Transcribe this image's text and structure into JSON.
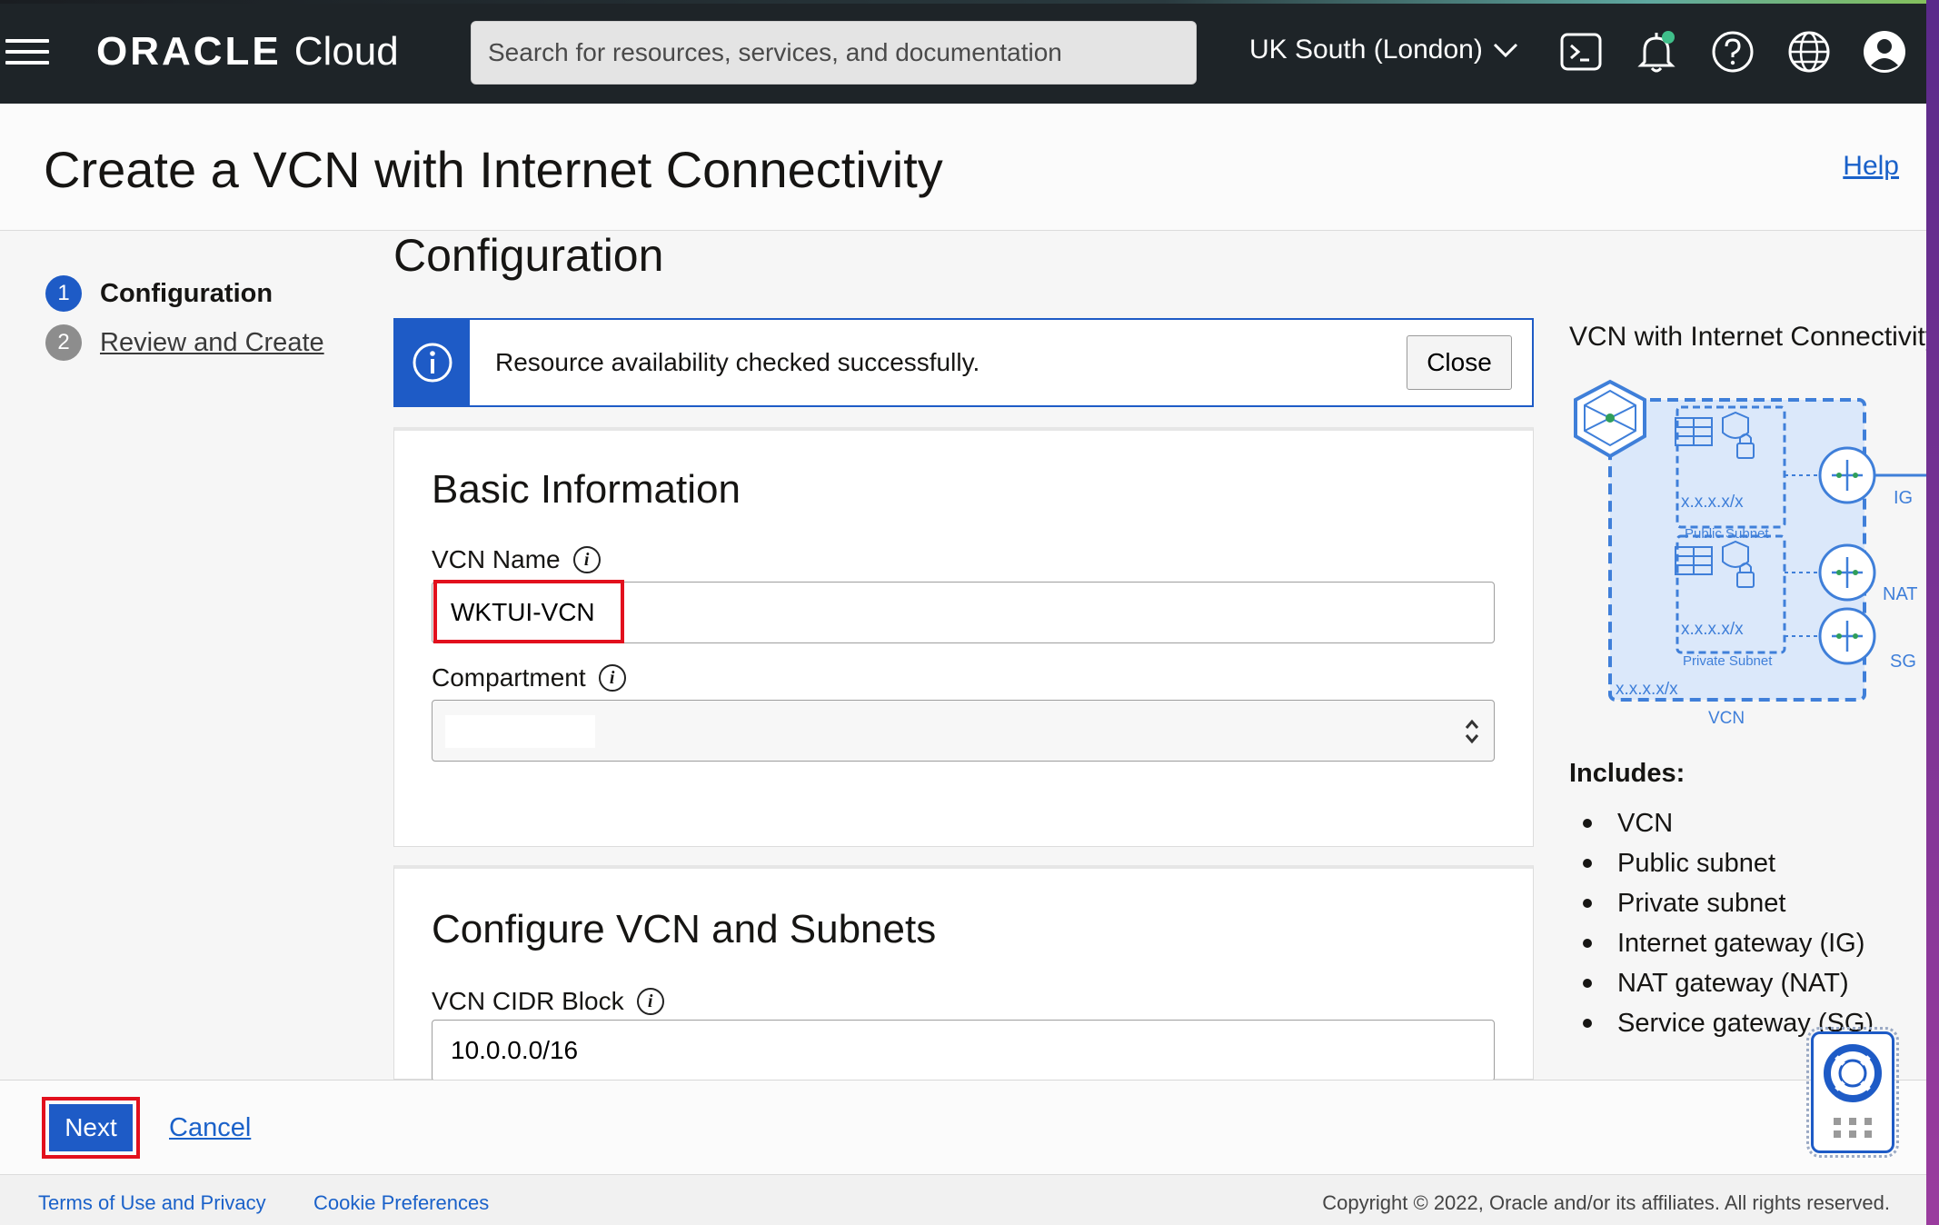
{
  "topbar": {
    "brand_oracle": "ORACLE",
    "brand_cloud": "Cloud",
    "search_placeholder": "Search for resources, services, and documentation",
    "region": "UK South (London)"
  },
  "header": {
    "title": "Create a VCN with Internet Connectivity",
    "help": "Help"
  },
  "steps": [
    {
      "num": "1",
      "label": "Configuration"
    },
    {
      "num": "2",
      "label": "Review and Create"
    }
  ],
  "main": {
    "title": "Configuration",
    "banner_message": "Resource availability checked successfully.",
    "banner_close": "Close"
  },
  "basic_info": {
    "title": "Basic Information",
    "vcn_name_label": "VCN Name",
    "vcn_name_value": "WKTUI-VCN",
    "compartment_label": "Compartment"
  },
  "vcn_subnets": {
    "title": "Configure VCN and Subnets",
    "cidr_label": "VCN CIDR Block",
    "cidr_value": "10.0.0.0/16"
  },
  "diagram": {
    "title": "VCN with Internet Connectivity",
    "public_cidr": "x.x.x.x/x",
    "public_label": "Public Subnet",
    "private_cidr": "x.x.x.x/x",
    "private_label": "Private Subnet",
    "vcn_cidr": "x.x.x.x/x",
    "vcn_label": "VCN",
    "ig": "IG",
    "nat": "NAT",
    "sg": "SG"
  },
  "includes": {
    "title": "Includes:",
    "items": [
      "VCN",
      "Public subnet",
      "Private subnet",
      "Internet gateway (IG)",
      "NAT gateway (NAT)",
      "Service gateway (SG)"
    ]
  },
  "actions": {
    "next": "Next",
    "cancel": "Cancel"
  },
  "footer": {
    "terms": "Terms of Use and Privacy",
    "cookies": "Cookie Preferences",
    "copyright": "Copyright © 2022, Oracle and/or its affiliates. All rights reserved."
  },
  "colors": {
    "accent": "#1e5bc6",
    "highlight": "#e2101d",
    "topbar": "#1e2428"
  }
}
